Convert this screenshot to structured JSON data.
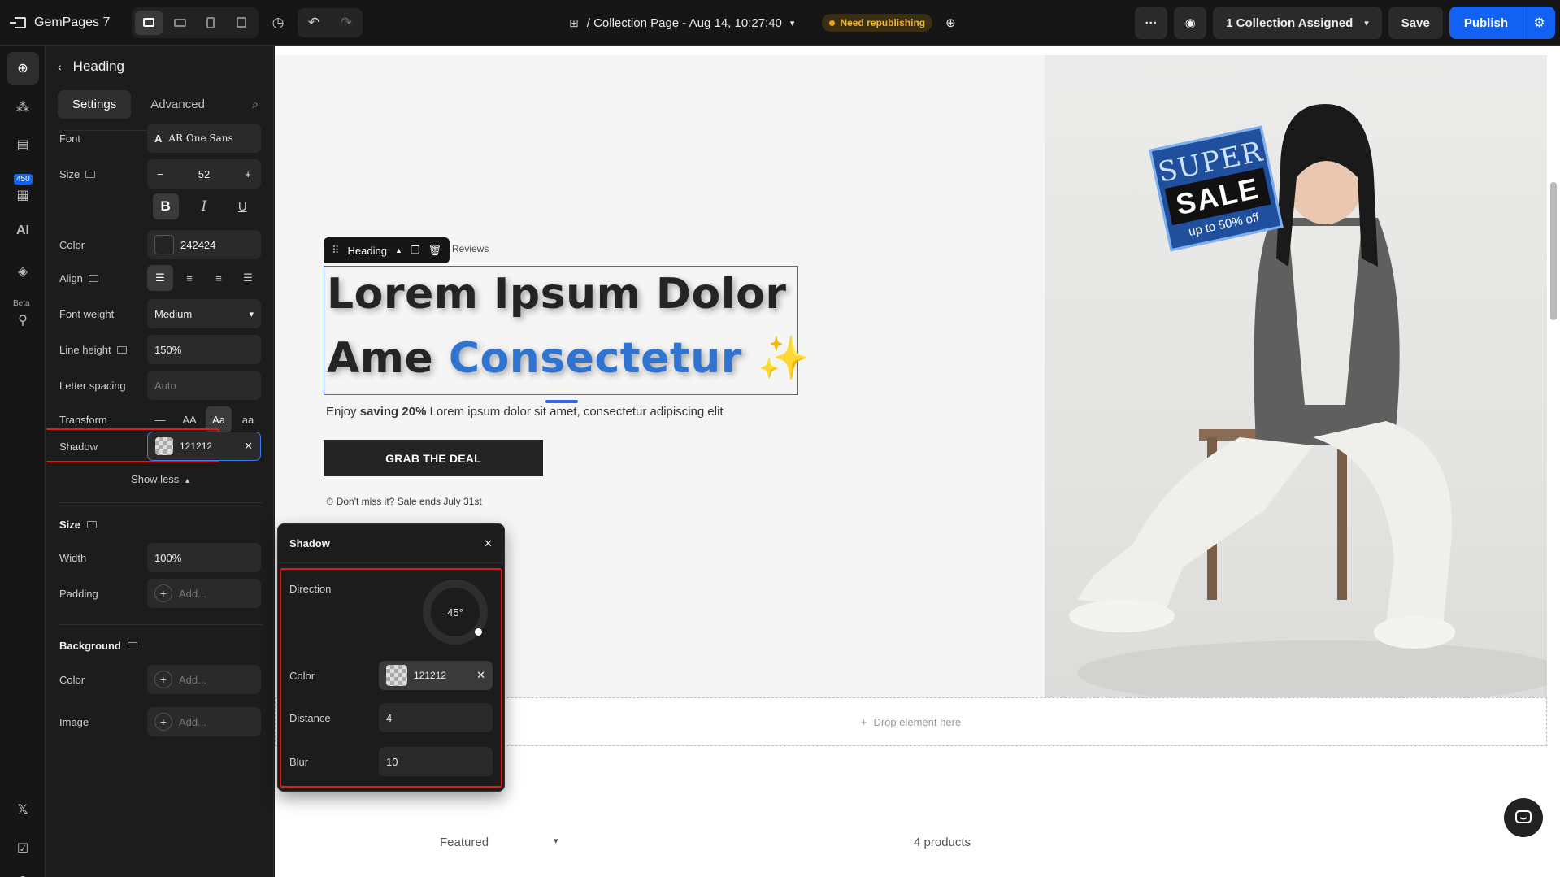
{
  "topbar": {
    "brand": "GemPages 7",
    "page_title": "/ Collection Page - Aug 14, 10:27:40",
    "status_badge": "Need republishing",
    "collection_assigned": "1 Collection Assigned",
    "save": "Save",
    "publish": "Publish"
  },
  "rail": {
    "count_badge": "450",
    "ai_label": "AI",
    "beta_label": "Beta"
  },
  "panel": {
    "title": "Heading",
    "tabs": [
      "Settings",
      "Advanced"
    ],
    "font_label": "Font",
    "font_value": "AR One Sans",
    "size_label": "Size",
    "size_value": "52",
    "color_label": "Color",
    "color_value": "242424",
    "align_label": "Align",
    "font_weight_label": "Font weight",
    "font_weight_value": "Medium",
    "line_height_label": "Line height",
    "line_height_value": "150%",
    "letter_spacing_label": "Letter spacing",
    "letter_spacing_placeholder": "Auto",
    "transform_label": "Transform",
    "transform_options": [
      "—",
      "AA",
      "Aa",
      "aa"
    ],
    "transform_selected": "Aa",
    "shadow_label": "Shadow",
    "shadow_value": "121212",
    "show_less": "Show less",
    "size_section": "Size",
    "width_label": "Width",
    "width_value": "100%",
    "padding_label": "Padding",
    "add_placeholder": "Add...",
    "background_section": "Background",
    "bg_color_label": "Color",
    "bg_image_label": "Image"
  },
  "popover": {
    "title": "Shadow",
    "direction_label": "Direction",
    "direction_value": "45°",
    "color_label": "Color",
    "color_value": "121212",
    "distance_label": "Distance",
    "distance_value": "4",
    "blur_label": "Blur",
    "blur_value": "10"
  },
  "canvas": {
    "toolbar_label": "Heading",
    "reviews_text": "Reviews",
    "heading_line1": "Lorem Ipsum Dolor",
    "heading_line2_a": "Ame ",
    "heading_line2_b": "Consectetur",
    "heading_emoji": "✨",
    "sub_pre": "Enjoy ",
    "sub_bold": "saving 20%",
    "sub_post": " Lorem ipsum dolor sit amet, consectetur adipiscing elit",
    "cta": "GRAB THE DEAL",
    "deal_note": "⏱ Don't miss it? Sale ends July 31st",
    "sticker_top": "SUPER",
    "sticker_mid": "SALE",
    "sticker_bottom": "up to 50% off",
    "dropzone": "Drop element here",
    "sort_value": "Featured",
    "product_count": "4 products"
  },
  "colors": {
    "accent_blue": "#1261f2",
    "heading_text": "#242424",
    "heading_accent": "#2f74d0",
    "highlight_red": "#e0191f",
    "warning": "#f2b430"
  }
}
